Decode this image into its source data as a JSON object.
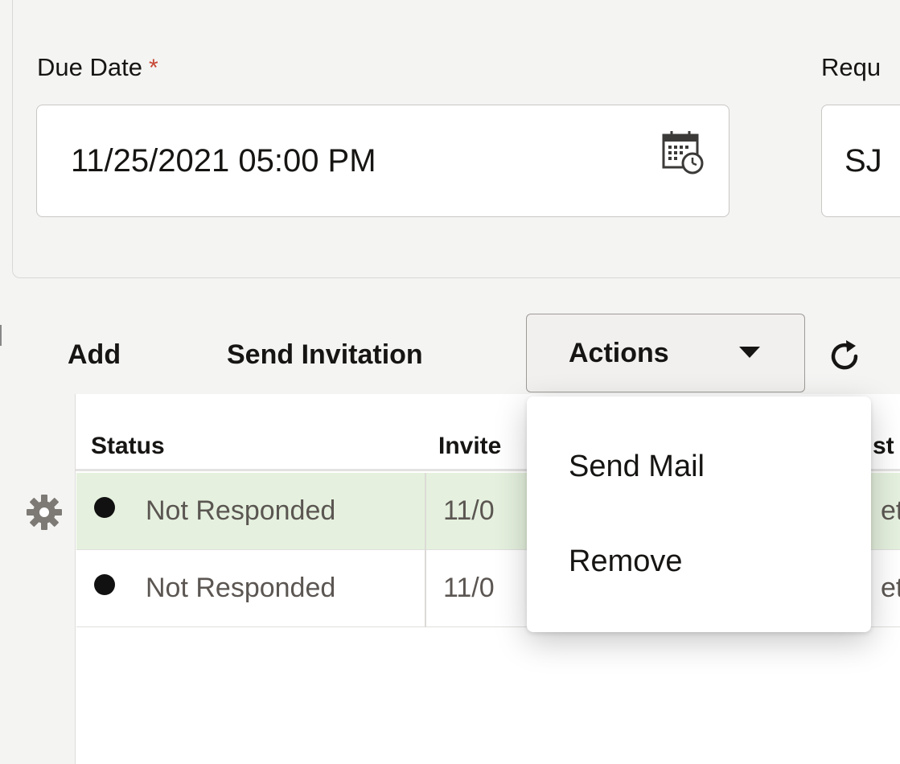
{
  "form": {
    "due_date_label": "Due Date",
    "due_date_required_mark": "*",
    "due_date_value": "11/25/2021 05:00 PM",
    "second_label": "Requ",
    "second_value": "SJ"
  },
  "toolbar": {
    "add_label": "Add",
    "send_invitation_label": "Send Invitation",
    "actions_label": "Actions"
  },
  "table": {
    "columns": [
      "Status",
      "Invite",
      "st"
    ],
    "rows": [
      {
        "status": "Not Responded",
        "invited": "11/0",
        "edge": "et",
        "selected": true
      },
      {
        "status": "Not Responded",
        "invited": "11/0",
        "edge": "et",
        "selected": false
      }
    ]
  },
  "actions_menu": {
    "items": [
      "Send Mail",
      "Remove"
    ]
  },
  "colors": {
    "required": "#c74634",
    "selected_row": "#e5f1de",
    "background": "#f4f4f3"
  },
  "icons": [
    "calendar-clock-icon",
    "refresh-icon",
    "caret-down-icon",
    "gear-icon",
    "status-dot-icon"
  ]
}
